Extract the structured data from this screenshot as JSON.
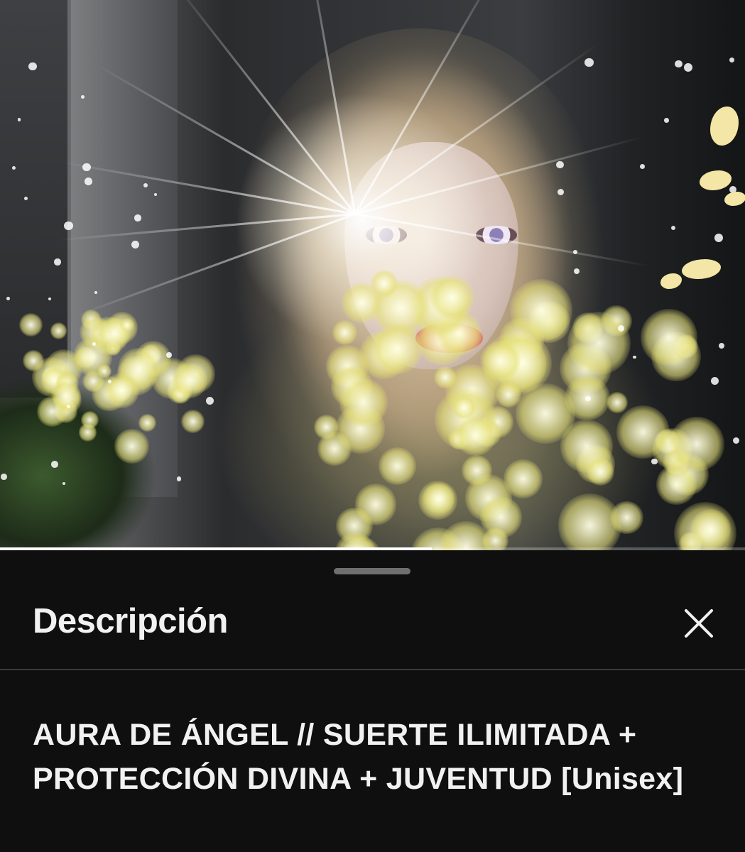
{
  "video": {
    "progress_fraction": 0.58
  },
  "description_panel": {
    "title": "Descripción",
    "close_icon": "close-icon",
    "video_title": "AURA DE ÁNGEL // SUERTE ILIMITADA + PROTECCIÓN DIVINA + JUVENTUD [Unisex]"
  }
}
